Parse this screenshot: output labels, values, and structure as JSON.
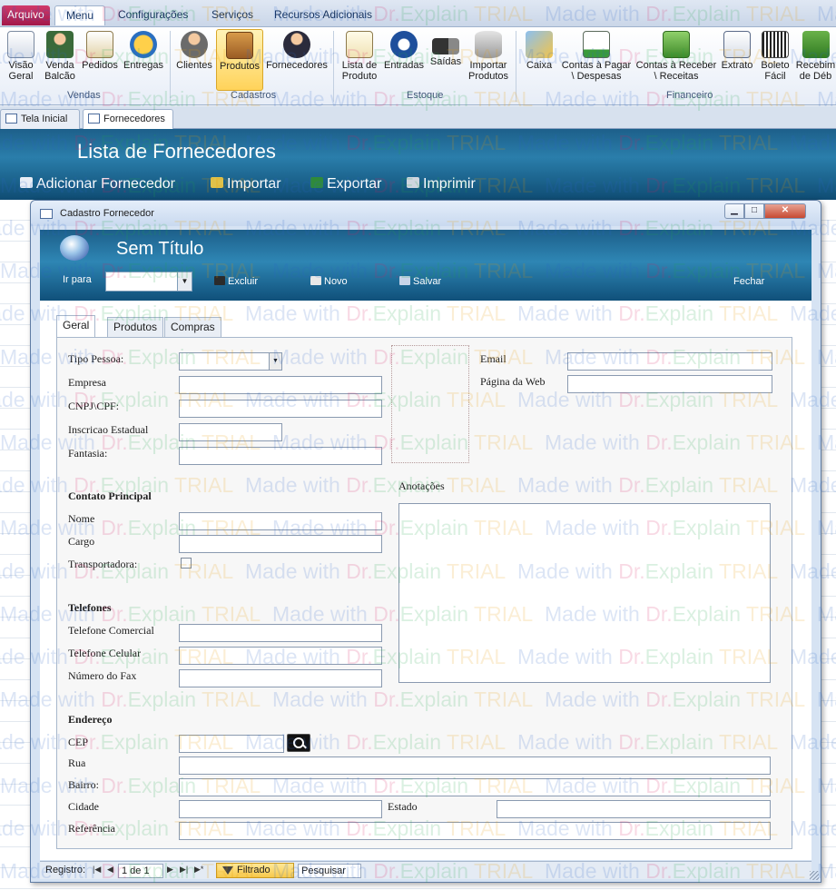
{
  "ribbon": {
    "tabs": [
      "Arquivo",
      "Menu",
      "Configurações",
      "Serviços",
      "Recursos Adicionais"
    ],
    "buttons": [
      {
        "label1": "Visão",
        "label2": "Geral",
        "icon": "dashboard-icon"
      },
      {
        "label1": "Venda",
        "label2": "Balcão",
        "icon": "cashier-person-icon"
      },
      {
        "label1": "Pedidos",
        "label2": "",
        "icon": "documents-icon"
      },
      {
        "label1": "Entregas",
        "label2": "",
        "icon": "delivery-icon"
      },
      {
        "label1": "Clientes",
        "label2": "",
        "icon": "person-icon"
      },
      {
        "label1": "Produtos",
        "label2": "",
        "icon": "boxes-icon"
      },
      {
        "label1": "Fornecedores",
        "label2": "",
        "icon": "supplier-person-icon"
      },
      {
        "label1": "Lista de",
        "label2": "Produto",
        "icon": "checklist-icon"
      },
      {
        "label1": "Entradas",
        "label2": "",
        "icon": "inbound-icon"
      },
      {
        "label1": "Saídas",
        "label2": "",
        "icon": "truck-icon"
      },
      {
        "label1": "Importar",
        "label2": "Produtos",
        "icon": "database-import-icon"
      },
      {
        "label1": "Caixa",
        "label2": "",
        "icon": "cash-register-icon"
      },
      {
        "label1": "Contas à Pagar",
        "label2": "\\ Despesas",
        "icon": "calendar-payable-icon"
      },
      {
        "label1": "Contas à Receber",
        "label2": "\\ Receitas",
        "icon": "money-receivable-icon"
      },
      {
        "label1": "Extrato",
        "label2": "",
        "icon": "statement-icon"
      },
      {
        "label1": "Boleto",
        "label2": "Fácil",
        "icon": "barcode-boleto-icon"
      },
      {
        "label1": "Recebim",
        "label2": "de Déb",
        "icon": "payment-receive-icon"
      }
    ],
    "groups": [
      "Vendas",
      "Cadastros",
      "Estoque",
      "Financeiro"
    ]
  },
  "doc_tabs": [
    "Tela Inicial",
    "Fornecedores"
  ],
  "list": {
    "title": "Lista de Fornecedores",
    "actions": [
      "Adicionar Fornecedor",
      "Importar",
      "Exportar",
      "Imprimir"
    ]
  },
  "dialog": {
    "title": "Cadastro Fornecedor",
    "window_buttons": {
      "min": "▁",
      "max": "□",
      "close": "✕"
    },
    "header_title": "Sem Título",
    "irpara": "Ir para",
    "actions": {
      "excluir": "Excluir",
      "novo": "Novo",
      "salvar": "Salvar",
      "fechar": "Fechar"
    }
  },
  "form_tabs": [
    "Geral",
    "Produtos",
    "Compras"
  ],
  "fields": {
    "tipo_pessoa": "Tipo Pessoa:",
    "empresa": "Empresa",
    "cnpj": "CNPJ\\CPF:",
    "inscricao": "Inscricao Estadual",
    "fantasia": "Fantasia:",
    "email": "Email",
    "web": "Página da Web",
    "anotacoes": "Anotações",
    "contato_principal": "Contato Principal",
    "nome": "Nome",
    "cargo": "Cargo",
    "transportadora": "Transportadora:",
    "telefones": "Telefones",
    "tel_comercial": "Telefone Comercial",
    "tel_celular": "Telefone Celular",
    "fax": "Número do Fax",
    "endereco": "Endereço",
    "cep": "CEP",
    "rua": "Rua",
    "bairro": "Bairro:",
    "cidade": "Cidade",
    "estado": "Estado",
    "referencia": "Referência"
  },
  "nav": {
    "label": "Registro:",
    "first": "|◀",
    "prev": "◀",
    "position": "1 de 1",
    "next": "▶",
    "last": "▶|",
    "new": "▶*",
    "filter": "Filtrado",
    "search": "Pesquisar"
  },
  "watermark": {
    "made": "Made with ",
    "dr": "Dr.",
    "explain": "Explain ",
    "trial": "TRIAL"
  },
  "colors": {
    "header_blue": "#1d5f8a",
    "accent_pink": "#d81b60",
    "active_button": "#ffd35a",
    "filter_yellow": "#f7c94c"
  }
}
